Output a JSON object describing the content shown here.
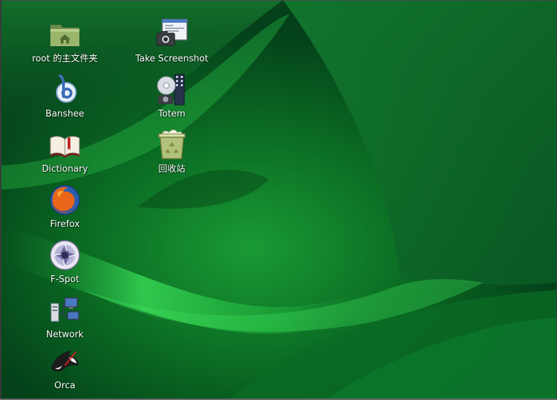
{
  "desktop": {
    "icons": [
      {
        "id": "home",
        "label": "root 的主文件夹",
        "icon": "home-folder-icon"
      },
      {
        "id": "banshee",
        "label": "Banshee",
        "icon": "banshee-icon"
      },
      {
        "id": "dictionary",
        "label": "Dictionary",
        "icon": "dictionary-icon"
      },
      {
        "id": "firefox",
        "label": "Firefox",
        "icon": "firefox-icon"
      },
      {
        "id": "fspot",
        "label": "F-Spot",
        "icon": "fspot-icon"
      },
      {
        "id": "network",
        "label": "Network",
        "icon": "network-icon"
      },
      {
        "id": "orca",
        "label": "Orca",
        "icon": "orca-icon"
      },
      {
        "id": "screenshot",
        "label": "Take Screenshot",
        "icon": "screenshot-icon"
      },
      {
        "id": "totem",
        "label": "Totem",
        "icon": "totem-icon"
      },
      {
        "id": "trash",
        "label": "回收站",
        "icon": "trash-icon"
      }
    ]
  },
  "colors": {
    "wallpaper_dark": "#03300f",
    "wallpaper_mid": "#0b7a2a",
    "wallpaper_bright": "#2fd84a",
    "label_text": "#ffffff"
  }
}
